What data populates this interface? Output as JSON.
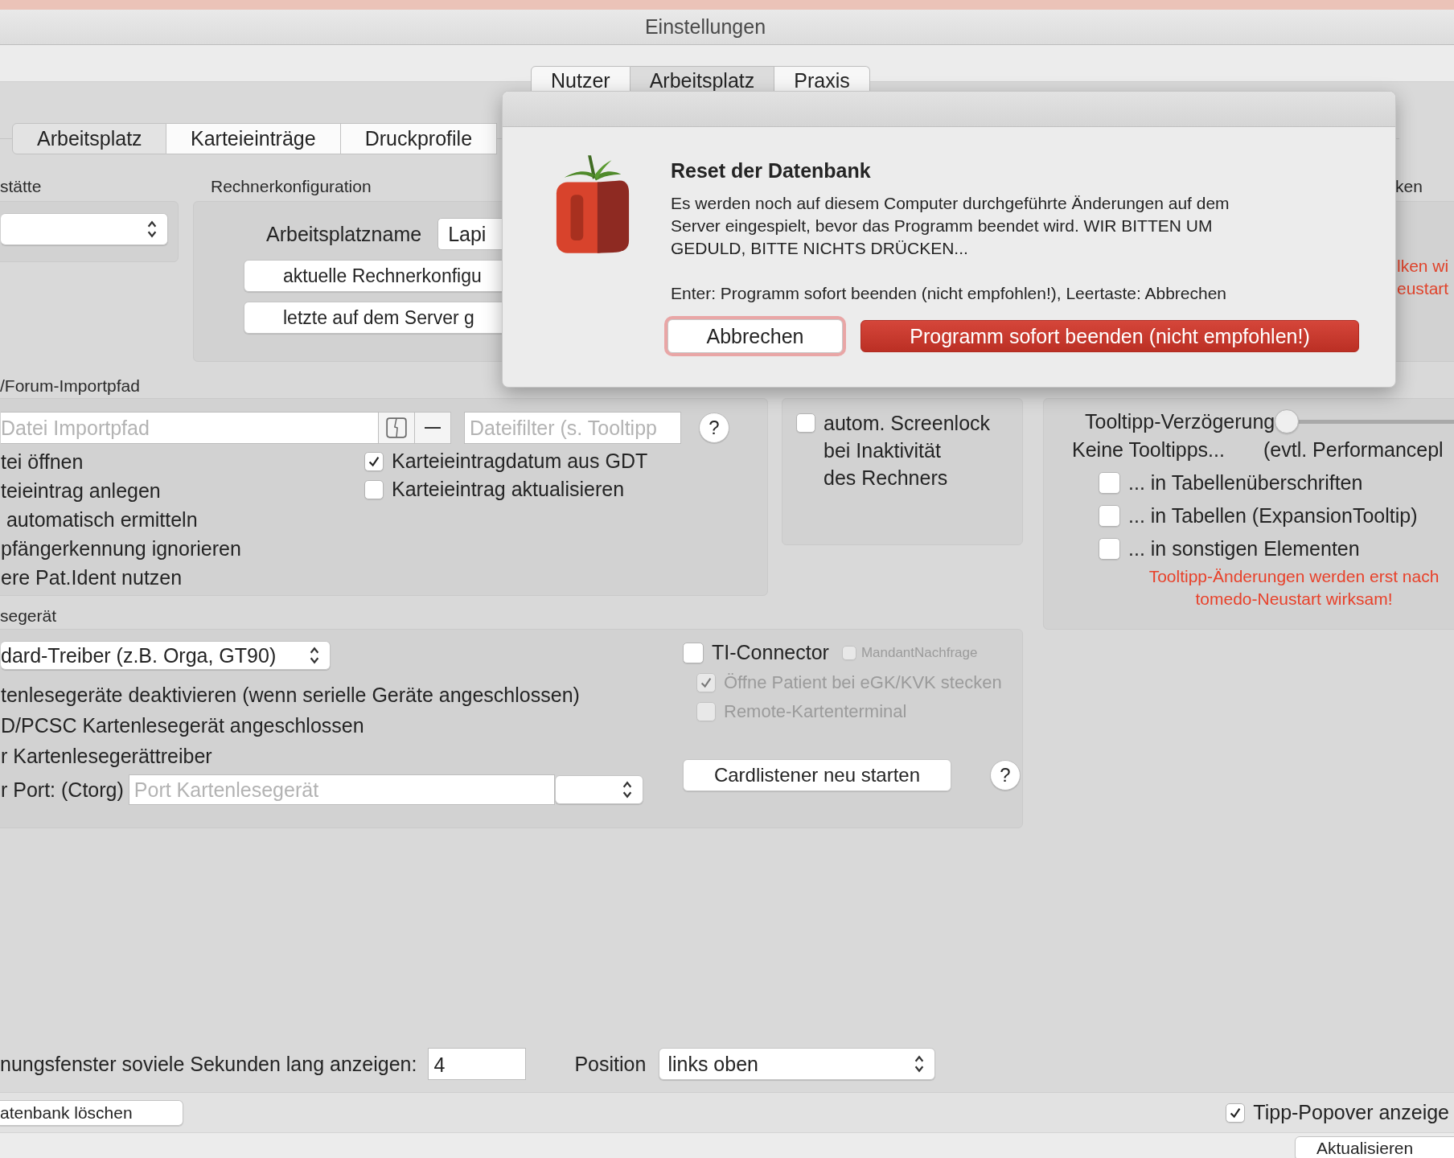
{
  "window": {
    "title": "Einstellungen"
  },
  "main_tabs": [
    {
      "label": "Nutzer",
      "selected": false
    },
    {
      "label": "Arbeitsplatz",
      "selected": true
    },
    {
      "label": "Praxis",
      "selected": false
    }
  ],
  "sub_tabs": [
    {
      "label": "Arbeitsplatz",
      "selected": true
    },
    {
      "label": "Karteieinträge",
      "selected": false
    },
    {
      "label": "Druckprofile",
      "selected": false
    }
  ],
  "location_section": {
    "label": "stätte"
  },
  "computer_config": {
    "label": "Rechnerkonfiguration",
    "name_label": "Arbeitsplatzname",
    "name_value": "Lapi",
    "buttons": [
      "aktuelle Rechnerkonfigu",
      "letzte auf dem Server g"
    ]
  },
  "right_section": {
    "label": "ken",
    "notes": [
      "lken wi",
      "eustart"
    ]
  },
  "import_section": {
    "label": "/Forum-Importpfad",
    "path_placeholder": "Datei Importpfad",
    "filter_placeholder": "Dateifilter (s. Tooltipp",
    "help": "?",
    "options": [
      "tei öffnen",
      "teieintrag anlegen",
      " automatisch ermitteln",
      "pfängerkennung ignorieren",
      "ere Pat.Ident nutzen"
    ],
    "checkboxes": [
      {
        "label": "Karteieintragdatum aus GDT",
        "checked": true
      },
      {
        "label": "Karteieintrag aktualisieren",
        "checked": false
      }
    ]
  },
  "autologout": {
    "checkbox": {
      "label": "autom. Screenlock\nbei Inaktivität\ndes Rechners",
      "checked": false
    }
  },
  "tooltips": {
    "delay": {
      "label": "Tooltipp-Verzögerung",
      "level": 0
    },
    "none_label": "Keine Tooltipps...",
    "none_note": "(evtl. Performancepl",
    "checkboxes": [
      {
        "label": "... in Tabellenüberschriften",
        "checked": false
      },
      {
        "label": "... in Tabellen (ExpansionTooltip)",
        "checked": false
      },
      {
        "label": "... in sonstigen Elementen",
        "checked": false
      }
    ],
    "warning": "Tooltipp-Änderungen werden erst nach\ntomedo-Neustart wirksam!"
  },
  "card_reader": {
    "label": "segerät",
    "driver": "dard-Treiber (z.B. Orga, GT90)",
    "options": [
      "tenlesegeräte deaktivieren (wenn serielle Geräte angeschlossen)",
      "D/PCSC Kartenlesegerät angeschlossen",
      "r Kartenlesegerättreiber"
    ],
    "port_label": "r Port: (Ctorg)",
    "port_placeholder": "Port Kartenlesegerät",
    "checkboxes": [
      {
        "kind": "large",
        "label": "TI-Connector",
        "checked": false,
        "disabled": false
      },
      {
        "kind": "small",
        "label": "MandantNachfrage",
        "checked": false,
        "disabled": true
      },
      {
        "kind": "normal",
        "label": "Öffne Patient bei eGK/KVK stecken",
        "checked": true,
        "disabled": true
      },
      {
        "kind": "normal",
        "label": "Remote-Kartenterminal",
        "checked": false,
        "disabled": true
      }
    ],
    "restart_button": "Cardlistener neu starten",
    "help": "?"
  },
  "notification": {
    "label": "nungsfenster soviele Sekunden lang anzeigen:",
    "seconds": "4",
    "position_label": "Position",
    "position": "links oben"
  },
  "footer": {
    "delete_button": "atenbank löschen",
    "popover": {
      "label": "Tipp-Popover anzeige",
      "checked": true
    },
    "update_button": "Aktualisieren"
  },
  "dialog": {
    "title": "Reset der Datenbank",
    "message": "Es werden noch auf diesem Computer durchgeführte Änderungen auf dem\nServer eingespielt, bevor das Programm beendet wird. WIR BITTEN UM\nGEDULD, BITTE NICHTS DRÜCKEN...",
    "hint": "Enter: Programm sofort beenden (nicht empfohlen!), Leertaste: Abbrechen",
    "buttons": [
      {
        "kind": "cancel",
        "label": "Abbrechen"
      },
      {
        "kind": "destructive",
        "label": "Programm sofort beenden (nicht empfohlen!)"
      }
    ]
  }
}
